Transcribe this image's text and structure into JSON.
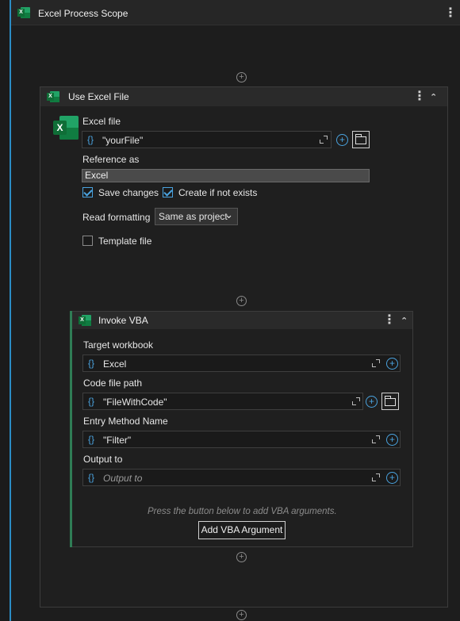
{
  "scope": {
    "title": "Excel Process Scope"
  },
  "use_excel": {
    "title": "Use Excel File",
    "excel_file_label": "Excel file",
    "excel_file_value": "\"yourFile\"",
    "reference_label": "Reference as",
    "reference_value": "Excel",
    "save_changes_label": "Save changes",
    "save_changes_checked": true,
    "create_label": "Create if not exists",
    "create_checked": true,
    "read_formatting_label": "Read formatting",
    "read_formatting_value": "Same as project",
    "template_label": "Template file",
    "template_checked": false
  },
  "invoke_vba": {
    "title": "Invoke VBA",
    "target_label": "Target workbook",
    "target_value": "Excel",
    "code_path_label": "Code file path",
    "code_path_value": "\"FileWithCode\"",
    "entry_label": "Entry Method Name",
    "entry_value": "\"Filter\"",
    "output_label": "Output to",
    "output_placeholder": "Output to",
    "hint": "Press the button below to add VBA arguments.",
    "add_button": "Add VBA Argument"
  },
  "glyphs": {
    "brace": "{}",
    "kebab": "⋮",
    "collapse": "⌃",
    "chevron": "⌄",
    "plus": "+",
    "excel_letter": "X"
  },
  "colors": {
    "accent_blue": "#2b8cc4",
    "card_accent": "#2f7d55",
    "excel_green": "#21a366"
  }
}
